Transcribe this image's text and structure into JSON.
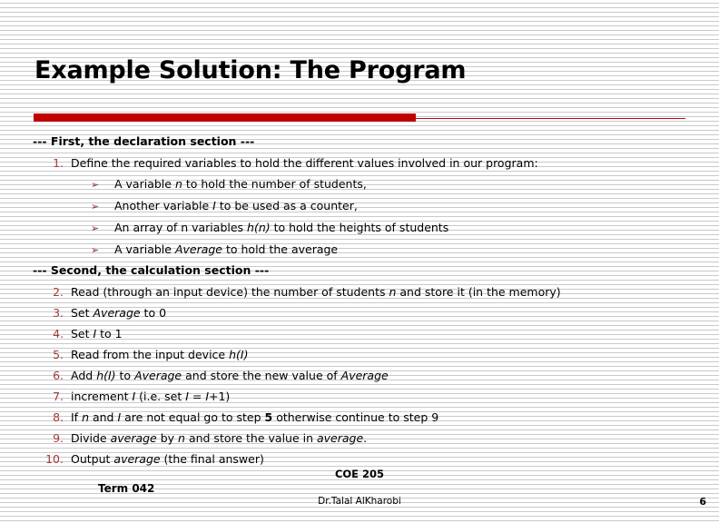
{
  "slide": {
    "title": "Example Solution: The Program",
    "accent_color": "#c00000",
    "number_color": "#a33a3a",
    "bullet_color": "#8f2b2b",
    "text_color": "#000000",
    "background_color": "#ffffff"
  },
  "sections": {
    "declaration_header": "--- First, the declaration section ---",
    "calculation_header": "--- Second, the calculation section ---"
  },
  "declaration": {
    "item1": {
      "num": "1.",
      "text": "Define the required variables to hold the different values involved in our program:"
    },
    "bullets": [
      {
        "glyph": "➢",
        "pre": "A variable ",
        "var": "n",
        "post": " to hold the number of students,"
      },
      {
        "glyph": "➢",
        "pre": "Another variable ",
        "var": "I",
        "post": " to be used as a counter,"
      },
      {
        "glyph": "➢",
        "pre": "An array of n variables ",
        "var": "h(n)",
        "post": " to hold the heights of students"
      },
      {
        "glyph": "➢",
        "pre": "A variable ",
        "var": "Average",
        "post": " to hold the average"
      }
    ]
  },
  "calculation": {
    "steps": [
      {
        "num": "2.",
        "p1": "Read (through an input device) the number of students ",
        "v1": "n",
        "p2": " and store it (in the memory)",
        "v2": "",
        "p3": "",
        "v3": "",
        "p4": ""
      },
      {
        "num": "3.",
        "p1": "Set ",
        "v1": "Average",
        "p2": " to 0",
        "v2": "",
        "p3": "",
        "v3": "",
        "p4": ""
      },
      {
        "num": "4.",
        "p1": "Set ",
        "v1": "I",
        "p2": " to 1",
        "v2": "",
        "p3": "",
        "v3": "",
        "p4": ""
      },
      {
        "num": "5.",
        "p1": "Read from the input device ",
        "v1": "h(I)",
        "p2": "",
        "v2": "",
        "p3": "",
        "v3": "",
        "p4": ""
      },
      {
        "num": "6.",
        "p1": "Add ",
        "v1": "h(I)",
        "p2": " to ",
        "v2": "Average",
        "p3": " and store the new value of ",
        "v3": "Average",
        "p4": ""
      },
      {
        "num": "7.",
        "p1": "increment ",
        "v1": "I",
        "p2": "  (i.e. set ",
        "v2": "I",
        "p3": " = ",
        "v3": "I",
        "p4": "+1)"
      },
      {
        "num": "8.",
        "p1": "If ",
        "v1": "n",
        "p2": " and ",
        "v2": "I",
        "p3": " are not equal go to step ",
        "v3": "",
        "p4": ""
      },
      {
        "num": "9.",
        "p1": "Divide  ",
        "v1": "average",
        "p2": " by ",
        "v2": "n",
        "p3": " and store the value in ",
        "v3": "average",
        "p4": "."
      },
      {
        "num": "10.",
        "p1": "Output ",
        "v1": "average",
        "p2": " (the final answer)",
        "v2": "",
        "p3": "",
        "v3": "",
        "p4": ""
      }
    ],
    "step8_bold": "5",
    "step8_tail": " otherwise continue to step 9"
  },
  "footer": {
    "course": "COE 205",
    "term": "Term 042",
    "author": "Dr.Talal AlKharobi",
    "page": "6"
  }
}
